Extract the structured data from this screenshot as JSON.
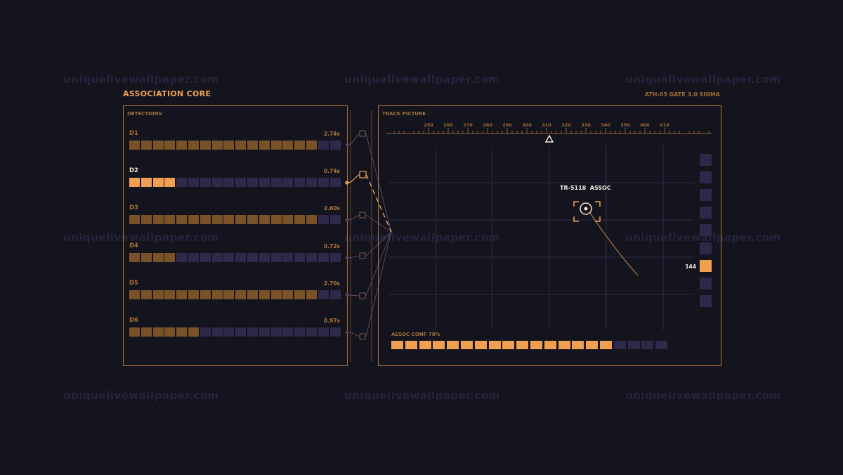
{
  "watermark": "uniquelivewallpaper.com",
  "header": {
    "title": "ASSOCIATION CORE",
    "meta": "ATH-05  GATE 3.0 SIGMA"
  },
  "left_panel": {
    "title": "DETECTIONS"
  },
  "right_panel": {
    "title": "TRACK PICTURE"
  },
  "colors": {
    "accent": "#f0a050",
    "accent_dim": "#7a5228",
    "cell_off": "#2c2a48",
    "background": "#14141f",
    "border": "#b0763a"
  },
  "detections": [
    {
      "id": "D1",
      "time": "2.74s",
      "filled": 16,
      "total": 18,
      "selected": false
    },
    {
      "id": "D2",
      "time": "0.74s",
      "filled": 4,
      "total": 18,
      "selected": true
    },
    {
      "id": "D3",
      "time": "2.60s",
      "filled": 16,
      "total": 18,
      "selected": false
    },
    {
      "id": "D4",
      "time": "0.72s",
      "filled": 4,
      "total": 18,
      "selected": false
    },
    {
      "id": "D5",
      "time": "2.70s",
      "filled": 16,
      "total": 18,
      "selected": false
    },
    {
      "id": "D6",
      "time": "0.97s",
      "filled": 6,
      "total": 18,
      "selected": false
    }
  ],
  "heading_scale": {
    "ticks": [
      "250",
      "260",
      "270",
      "280",
      "290",
      "300",
      "310",
      "320",
      "330",
      "340",
      "350",
      "000",
      "010"
    ],
    "marker": "310"
  },
  "track": {
    "label": "TR-5118  ASSOC",
    "icon": "target-reticle-icon"
  },
  "track_stack": {
    "value": "144",
    "cells": 9,
    "active_index": 6
  },
  "assoc_conf": {
    "label": "ASSOC CONF 78%",
    "value": 0.78,
    "cells": 20,
    "filled": 16
  }
}
